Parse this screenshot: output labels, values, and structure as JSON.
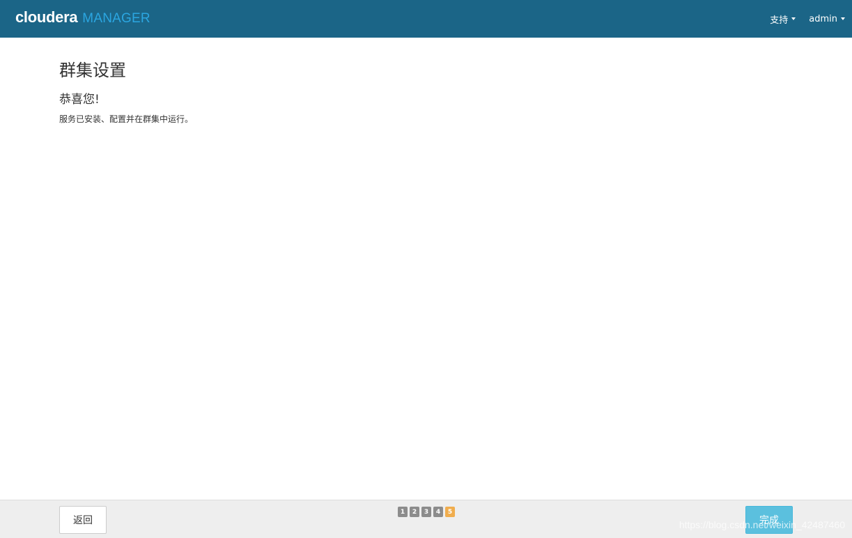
{
  "header": {
    "logo_brand": "cloudera",
    "logo_product": "MANAGER",
    "nav": [
      {
        "label": "支持"
      },
      {
        "label": "admin"
      }
    ]
  },
  "main": {
    "title": "群集设置",
    "subtitle": "恭喜您!",
    "message": "服务已安装、配置并在群集中运行。"
  },
  "footer": {
    "back_label": "返回",
    "steps": [
      "1",
      "2",
      "3",
      "4",
      "5"
    ],
    "active_step": 5,
    "finish_label": "完成"
  },
  "watermark": "https://blog.csdn.net/weixin_42487460",
  "colors": {
    "header_bg": "#1b6587",
    "brand_accent": "#2ba6e1",
    "step_inactive": "#8c8c8c",
    "step_active": "#f0ad4e",
    "primary_button": "#5bc0de",
    "footer_bg": "#eeeeee"
  }
}
